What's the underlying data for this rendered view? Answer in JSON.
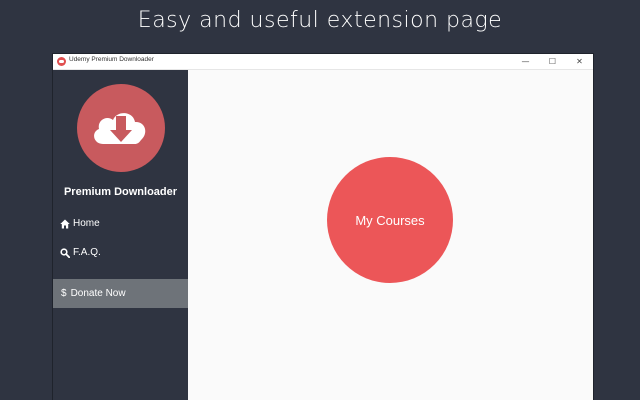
{
  "banner": {
    "headline": "Easy and useful extension page"
  },
  "window": {
    "title": "Udemy Premium Downloader",
    "controls": {
      "minimize": "—",
      "maximize": "☐",
      "close": "✕"
    }
  },
  "sidebar": {
    "logo_icon": "cloud-download-icon",
    "brand": "Premium Downloader",
    "items": [
      {
        "label": "Home",
        "icon": "home-icon"
      },
      {
        "label": "F.A.Q.",
        "icon": "search-icon"
      }
    ],
    "donate": {
      "symbol": "$",
      "label": "Donate Now"
    }
  },
  "main": {
    "courses_button": "My Courses"
  },
  "colors": {
    "background": "#2f3441",
    "sidebar": "#2f3441",
    "donate_bg": "#6e7379",
    "logo_circle": "#c85a5e",
    "courses_circle": "#ec5658",
    "main_bg": "#fafafa"
  }
}
